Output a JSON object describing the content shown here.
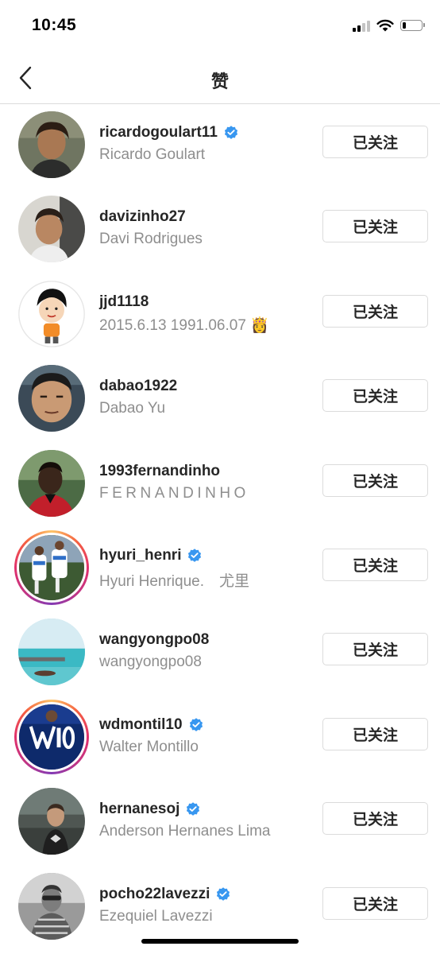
{
  "status_bar": {
    "time": "10:45",
    "signal_icon": "cellular-signal-icon",
    "wifi_icon": "wifi-icon",
    "battery_icon": "battery-icon",
    "battery_level": 0.2
  },
  "nav": {
    "back_icon": "chevron-left-icon",
    "title": "赞"
  },
  "colors": {
    "primary_text": "#262626",
    "secondary_text": "#8e8e8e",
    "verified_blue": "#3897f0",
    "button_border": "#dbdbdb"
  },
  "users": [
    {
      "username": "ricardogoulart11",
      "full_name": "Ricardo Goulart",
      "verified": true,
      "button_label": "已关注"
    },
    {
      "username": "davizinho27",
      "full_name": "Davi Rodrigues",
      "verified": false,
      "button_label": "已关注"
    },
    {
      "username": "jjd1118",
      "full_name": "2015.6.13 1991.06.07 👸",
      "verified": false,
      "button_label": "已关注"
    },
    {
      "username": "dabao1922",
      "full_name": "Dabao Yu",
      "verified": false,
      "button_label": "已关注"
    },
    {
      "username": "1993fernandinho",
      "full_name": "FERNANDINHO",
      "verified": false,
      "button_label": "已关注"
    },
    {
      "username": "hyuri_henri",
      "full_name": "Hyuri Henrique.　尤里",
      "verified": true,
      "button_label": "已关注"
    },
    {
      "username": "wangyongpo08",
      "full_name": "wangyongpo08",
      "verified": false,
      "button_label": "已关注"
    },
    {
      "username": "wdmontil10",
      "full_name": "Walter Montillo",
      "verified": true,
      "button_label": "已关注"
    },
    {
      "username": "hernanesoj",
      "full_name": "Anderson Hernanes Lima",
      "verified": true,
      "button_label": "已关注"
    },
    {
      "username": "pocho22lavezzi",
      "full_name": "Ezequiel Lavezzi",
      "verified": true,
      "button_label": "已关注"
    }
  ]
}
